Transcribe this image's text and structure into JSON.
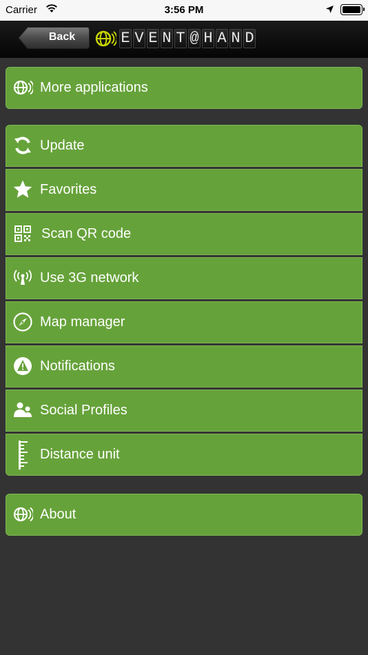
{
  "status_bar": {
    "carrier": "Carrier",
    "time": "3:56 PM"
  },
  "nav": {
    "back_label": "Back",
    "logo_text": [
      "E",
      "V",
      "E",
      "N",
      "T",
      "@",
      "H",
      "A",
      "N",
      "D"
    ]
  },
  "groups": [
    {
      "items": [
        {
          "label": "More applications",
          "icon": "globe-signal-icon"
        }
      ]
    },
    {
      "items": [
        {
          "label": "Update",
          "icon": "refresh-icon"
        },
        {
          "label": "Favorites",
          "icon": "star-icon"
        },
        {
          "label": "Scan QR code",
          "icon": "qr-code-icon"
        },
        {
          "label": "Use 3G network",
          "icon": "antenna-icon"
        },
        {
          "label": "Map manager",
          "icon": "compass-icon"
        },
        {
          "label": "Notifications",
          "icon": "alert-icon"
        },
        {
          "label": "Social Profiles",
          "icon": "people-icon"
        },
        {
          "label": "Distance unit",
          "icon": "ruler-icon"
        }
      ]
    },
    {
      "items": [
        {
          "label": "About",
          "icon": "globe-signal-icon"
        }
      ]
    }
  ],
  "colors": {
    "row_green": "#66a23a",
    "background": "#333333",
    "logo_accent": "#c8d400"
  }
}
